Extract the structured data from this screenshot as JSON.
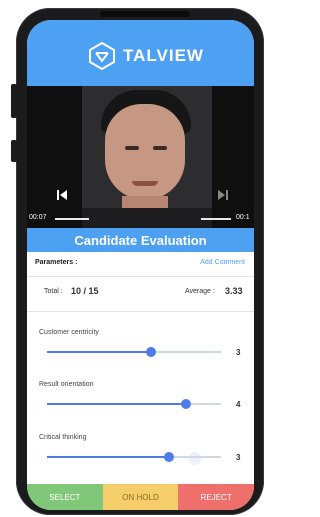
{
  "header": {
    "brand": "TALVIEW",
    "logo_icon": "talview-logo-icon",
    "color": "#4ea0f2"
  },
  "video": {
    "elapsed": "00:07",
    "remaining": "00:1",
    "prev_icon": "skip-previous-icon",
    "next_icon": "skip-next-icon"
  },
  "evaluation": {
    "title": "Candidate Evaluation",
    "parameters_label": "Parameters :",
    "add_comment": "Add Comment",
    "total_label": "Total :",
    "total_value": "10 / 15",
    "average_label": "Average :",
    "average_value": "3.33",
    "params": [
      {
        "name": "Customer centricity",
        "score": "3",
        "level": 0.6
      },
      {
        "name": "Result orientation",
        "score": "4",
        "level": 0.8
      },
      {
        "name": "Critical thinking",
        "score": "3",
        "level": 0.7
      }
    ]
  },
  "footer": {
    "select": "SELECT",
    "hold": "ON HOLD",
    "reject": "REJECT",
    "colors": {
      "select": "#80c77a",
      "hold": "#f5cd6b",
      "reject": "#ee6f6b"
    }
  }
}
